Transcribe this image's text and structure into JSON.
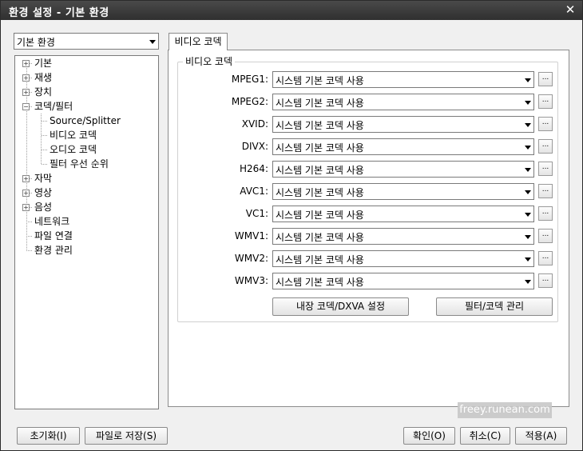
{
  "window": {
    "title": "환경 설정 - 기본 환경",
    "close_glyph": "✕"
  },
  "profile_combo": {
    "value": "기본 환경"
  },
  "tree": {
    "items": [
      {
        "label": "기본",
        "expander": "+"
      },
      {
        "label": "재생",
        "expander": "+"
      },
      {
        "label": "장치",
        "expander": "+"
      },
      {
        "label": "코덱/필터",
        "expander": "−"
      },
      {
        "label": "Source/Splitter"
      },
      {
        "label": "비디오 코덱"
      },
      {
        "label": "오디오 코덱"
      },
      {
        "label": "필터 우선 순위"
      },
      {
        "label": "자막",
        "expander": "+"
      },
      {
        "label": "영상",
        "expander": "+"
      },
      {
        "label": "음성",
        "expander": "+"
      },
      {
        "label": "네트워크"
      },
      {
        "label": "파일 연결"
      },
      {
        "label": "환경 관리"
      }
    ]
  },
  "tab": {
    "label": "비디오 코덱"
  },
  "group": {
    "label": "비디오 코덱"
  },
  "codecs": [
    {
      "label": "MPEG1:",
      "value": "시스템 기본 코덱 사용"
    },
    {
      "label": "MPEG2:",
      "value": "시스템 기본 코덱 사용"
    },
    {
      "label": "XVID:",
      "value": "시스템 기본 코덱 사용"
    },
    {
      "label": "DIVX:",
      "value": "시스템 기본 코덱 사용"
    },
    {
      "label": "H264:",
      "value": "시스템 기본 코덱 사용"
    },
    {
      "label": "AVC1:",
      "value": "시스템 기본 코덱 사용"
    },
    {
      "label": "VC1:",
      "value": "시스템 기본 코덱 사용"
    },
    {
      "label": "WMV1:",
      "value": "시스템 기본 코덱 사용"
    },
    {
      "label": "WMV2:",
      "value": "시스템 기본 코덱 사용"
    },
    {
      "label": "WMV3:",
      "value": "시스템 기본 코덱 사용"
    }
  ],
  "more_glyph": "...",
  "buttons": {
    "internal_codec": "내장 코덱/DXVA 설정",
    "filter_manage": "필터/코덱 관리",
    "reset": "초기화(I)",
    "save_file": "파일로 저장(S)",
    "ok": "확인(O)",
    "cancel": "취소(C)",
    "apply": "적용(A)"
  },
  "watermark": "freey.runean.com"
}
